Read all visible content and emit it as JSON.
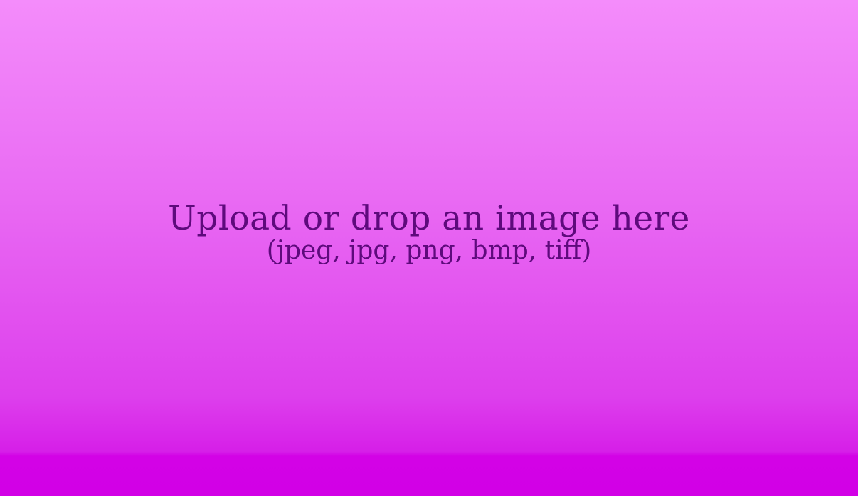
{
  "dropzone": {
    "title": "Upload or drop an image here",
    "formats": "(jpeg, jpg, png, bmp, tiff)"
  },
  "colors": {
    "text": "#5e0a7c",
    "gradient_top": "#f48cfb",
    "gradient_bottom": "#d200e6"
  }
}
